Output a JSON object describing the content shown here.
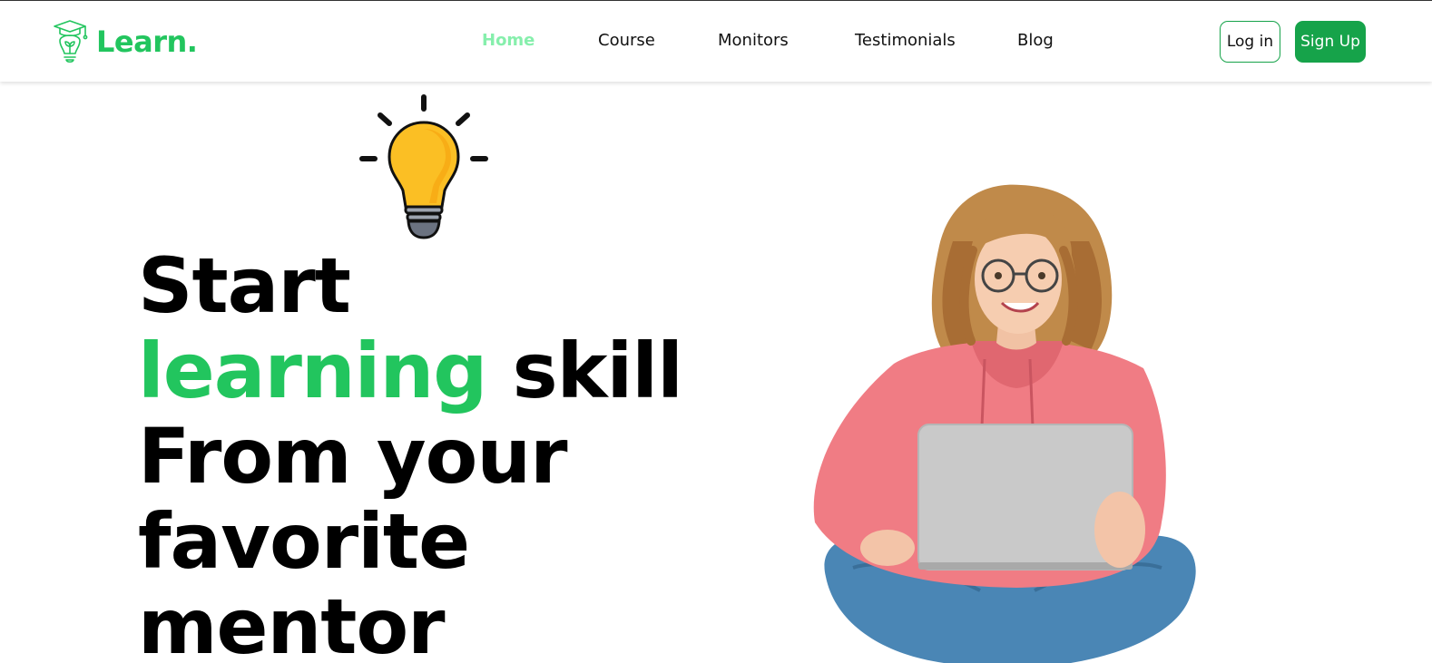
{
  "brand": {
    "name": "Learn.",
    "color": "#22c55e",
    "icon": "graduation-bulb-icon"
  },
  "nav": {
    "items": [
      {
        "label": "Home",
        "active": true
      },
      {
        "label": "Course",
        "active": false
      },
      {
        "label": "Monitors",
        "active": false
      },
      {
        "label": "Testimonials",
        "active": false
      },
      {
        "label": "Blog",
        "active": false
      }
    ],
    "active_color": "#86efac"
  },
  "auth": {
    "login_label": "Log in",
    "signup_label": "Sign Up",
    "accent": "#16a34a"
  },
  "hero": {
    "line1": "Start",
    "line2_accent": "learning",
    "line2_rest": " skill",
    "line3": "From your",
    "line4": "favorite",
    "line5": "mentor",
    "decoration_icon": "lightbulb-icon",
    "image": "student-with-laptop-photo"
  }
}
